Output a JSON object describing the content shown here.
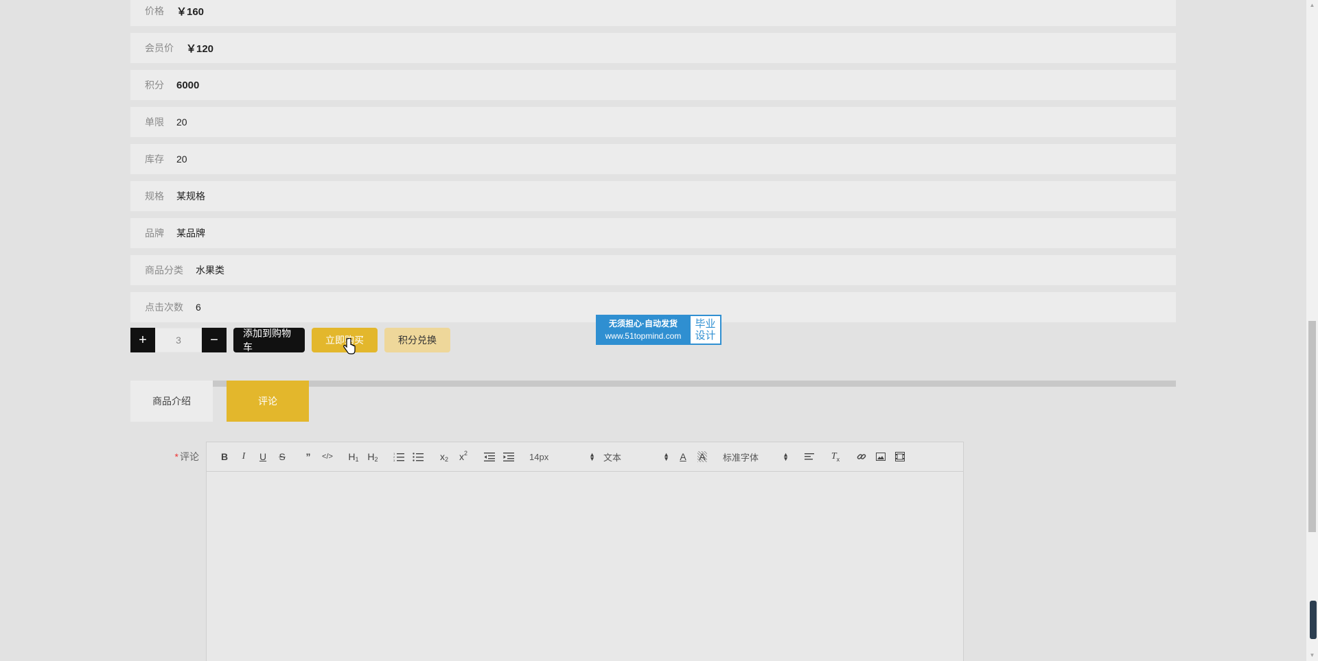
{
  "product_info": {
    "rows": [
      {
        "label": "价格",
        "value": "￥160",
        "bold": true
      },
      {
        "label": "会员价",
        "value": "￥120",
        "bold": true
      },
      {
        "label": "积分",
        "value": "6000",
        "bold": true
      },
      {
        "label": "单限",
        "value": "20",
        "bold": false
      },
      {
        "label": "库存",
        "value": "20",
        "bold": false
      },
      {
        "label": "规格",
        "value": "某规格",
        "bold": false
      },
      {
        "label": "品牌",
        "value": "某品牌",
        "bold": false
      },
      {
        "label": "商品分类",
        "value": "水果类",
        "bold": false
      },
      {
        "label": "点击次数",
        "value": "6",
        "bold": false
      }
    ]
  },
  "actions": {
    "plus": "+",
    "minus": "−",
    "quantity": "3",
    "add_to_cart": "添加到购物车",
    "buy_now": "立即购买",
    "points_exchange": "积分兑换"
  },
  "banner": {
    "line1": "无须担心·自动发货",
    "line2": "www.51topmind.com",
    "badge_line1": "毕业",
    "badge_line2": "设计"
  },
  "tabs": {
    "intro": "商品介绍",
    "comment": "评论"
  },
  "comment_form": {
    "required_mark": "*",
    "label": "评论",
    "toolbar": {
      "font_size": "14px",
      "block_type": "文本",
      "font_family": "标准字体"
    },
    "content": ""
  },
  "colors": {
    "accent": "#e3b72c",
    "accent_light": "#eed79a",
    "dark": "#111111",
    "banner_blue": "#2f8fd1"
  }
}
